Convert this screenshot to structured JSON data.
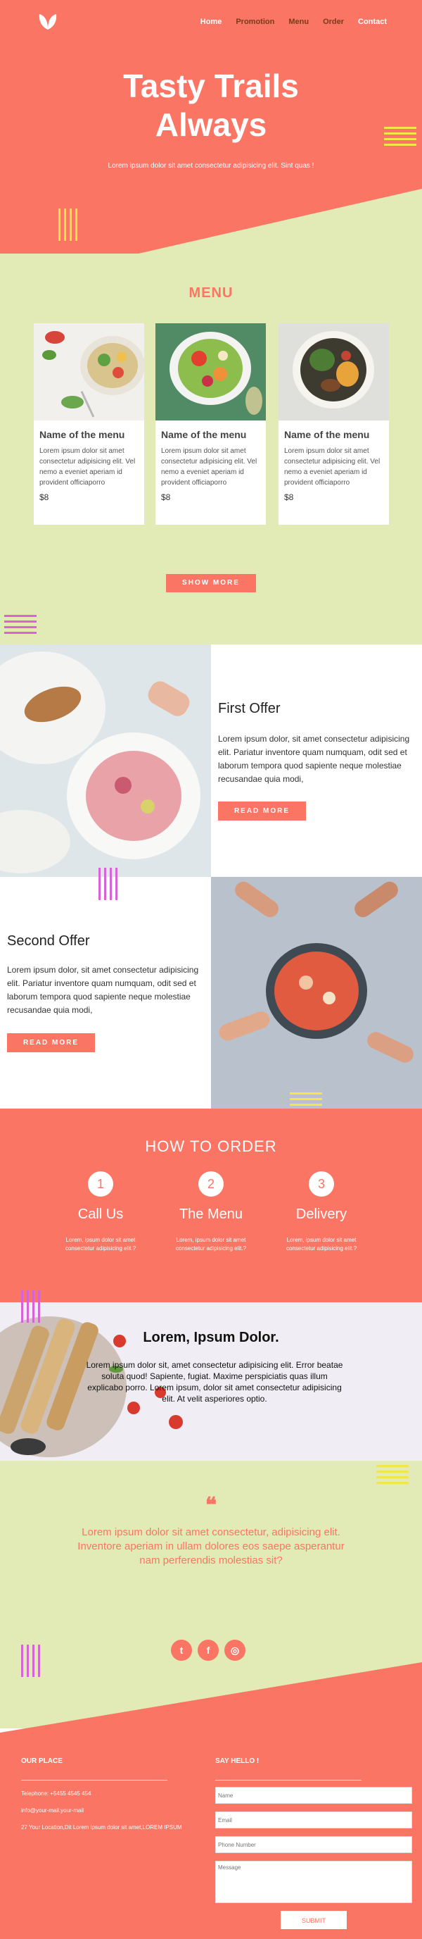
{
  "nav": {
    "items": [
      {
        "label": "Home"
      },
      {
        "label": "Promotion"
      },
      {
        "label": "Menu"
      },
      {
        "label": "Order"
      },
      {
        "label": "Contact"
      }
    ]
  },
  "hero": {
    "title_line1": "Tasty Trails",
    "title_line2": "Always",
    "subtitle": "Lorem ipsum dolor sit amet consectetur adipisicing elit. Sint quas !"
  },
  "menu": {
    "title": "MENU",
    "cards": [
      {
        "name": "Name of the menu",
        "desc": "Lorem ipsum dolor sit amet consectetur adipisicing elit. Vel nemo a eveniet aperiam id provident officiaporro",
        "price": "$8"
      },
      {
        "name": "Name of the menu",
        "desc": "Lorem ipsum dolor sit amet consectetur adipisicing elit. Vel nemo a eveniet aperiam id provident officiaporro",
        "price": "$8"
      },
      {
        "name": "Name of the menu",
        "desc": "Lorem ipsum dolor sit amet consectetur adipisicing elit. Vel nemo a eveniet aperiam id provident officiaporro",
        "price": "$8"
      }
    ],
    "show_more": "SHOW MORE"
  },
  "offers": {
    "first": {
      "title": "First Offer",
      "text": "Lorem ipsum dolor, sit amet consectetur adipisicing elit. Pariatur inventore quam numquam, odit sed et laborum tempora quod sapiente neque molestiae recusandae quia modi,",
      "button": "READ MORE"
    },
    "second": {
      "title": "Second Offer",
      "text": "Lorem ipsum dolor, sit amet consectetur adipisicing elit. Pariatur inventore quam numquam, odit sed et laborum tempora quod sapiente neque molestiae recusandae quia modi,",
      "button": "READ MORE"
    }
  },
  "how_to_order": {
    "title": "HOW TO ORDER",
    "steps": [
      {
        "number": "1",
        "name": "Call Us",
        "text": "Lorem, ipsum dolor sit amet consectetur adipisicing elit.?"
      },
      {
        "number": "2",
        "name": "The Menu",
        "text": "Lorem, ipsum dolor sit amet consectetur adipisicing elit.?"
      },
      {
        "number": "3",
        "name": "Delivery",
        "text": "Lorem, ipsum dolor sit amet consectetur adipisicing elit.?"
      }
    ]
  },
  "banner": {
    "title": "Lorem, Ipsum Dolor.",
    "text": "Lorem ipsum dolor sit, amet consectetur adipisicing elit. Error beatae soluta quod! Sapiente, fugiat. Maxime perspiciatis quas illum explicabo porro. Lorem ipsum, dolor sit amet consectetur adipisicing elit. At velit asperiores optio."
  },
  "quote": {
    "mark": "❝",
    "text": "Lorem ipsum dolor sit amet consectetur, adipisicing elit. Inventore aperiam in ullam dolores eos saepe asperantur nam perferendis molestias sit?"
  },
  "social": [
    {
      "icon": "twitter-icon",
      "glyph": "t"
    },
    {
      "icon": "facebook-icon",
      "glyph": "f"
    },
    {
      "icon": "instagram-icon",
      "glyph": "◎"
    }
  ],
  "footer": {
    "place_heading": "OUR PLACE",
    "phone": "Telephone: +5455 4545 454",
    "email": "info@your-mail.your-mail",
    "address": "27 Your Location,Dit Lorem ipsum dolor sit amet,LOREM IPSUM",
    "hello_heading": "SAY HELLO !",
    "placeholders": {
      "name": "Name",
      "email": "Email",
      "phone": "Phone Number",
      "message": "Message"
    },
    "submit": "SUBMIT"
  },
  "colors": {
    "accent": "#fb7565",
    "lime": "#e2ebb6",
    "yellow": "#f3e64a",
    "magenta": "#d764d6"
  }
}
